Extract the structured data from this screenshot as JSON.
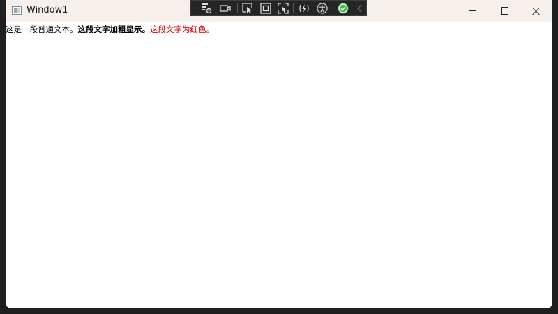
{
  "window": {
    "title": "Window1",
    "controls": {
      "minimize": "minimize",
      "maximize": "maximize",
      "close": "close"
    }
  },
  "debug_toolbar": {
    "icons": [
      "live-visual-tree-icon",
      "video-camera-icon",
      "select-element-icon",
      "display-layout-adorners-icon",
      "track-focused-element-icon",
      "hot-reload-icon",
      "accessibility-icon",
      "check-status-icon",
      "collapse-toolbar-icon"
    ],
    "check_color": "#3fb950"
  },
  "content": {
    "normal_text": "这是一段普通文本。",
    "bold_text": "这段文字加粗显示。",
    "red_text": "这段文字为红色。",
    "red_color": "#d40000"
  }
}
